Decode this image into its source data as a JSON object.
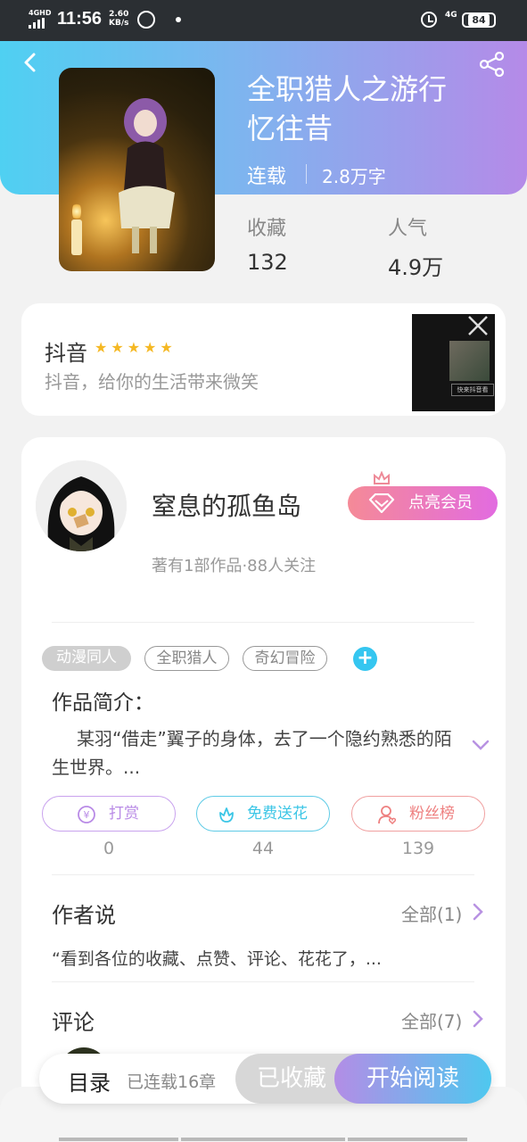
{
  "status_bar": {
    "network": "4GHD",
    "time": "11:56",
    "speed_value": "2.60",
    "speed_unit": "KB/s",
    "network_right": "4G",
    "battery": "84"
  },
  "book": {
    "title_line1": "全职猎人之游行",
    "title_line2": "忆往昔",
    "status": "连载",
    "word_count": "2.8万字",
    "stats": [
      {
        "label": "收藏",
        "value": "132"
      },
      {
        "label": "人气",
        "value": "4.9万"
      }
    ]
  },
  "ad": {
    "title": "抖音",
    "stars": "★★★★★",
    "description": "抖音，给你的生活带来微笑",
    "thumb_caption": "快来抖音看"
  },
  "author": {
    "name": "窒息的孤鱼岛",
    "meta": "著有1部作品·88人关注",
    "vip_label": "点亮会员"
  },
  "tags": [
    "动漫同人",
    "全职猎人",
    "奇幻冒险"
  ],
  "tag_add_symbol": "+",
  "synopsis": {
    "title": "作品简介：",
    "text": "某羽“借走”翼子的身体，去了一个隐约熟悉的陌生世界。..."
  },
  "actions": [
    {
      "label": "打赏",
      "count": "0",
      "color": "#b98be6"
    },
    {
      "label": "免费送花",
      "count": "44",
      "color": "#3cc6e6"
    },
    {
      "label": "粉丝榜",
      "count": "139",
      "color": "#ee8080"
    }
  ],
  "author_says": {
    "title": "作者说",
    "more": "全部(1)",
    "quote": "“看到各位的收藏、点赞、评论、花花了，..."
  },
  "comments": {
    "title": "评论",
    "more": "全部(7)"
  },
  "bottom_bar": {
    "toc_label": "目录",
    "toc_count": "已连载16章",
    "favorited_label": "已收藏",
    "read_label": "开始阅读"
  },
  "colors": {
    "header_gradient_start": "#4fd0f2",
    "header_gradient_end": "#b58ae8",
    "star": "#f5b823"
  }
}
